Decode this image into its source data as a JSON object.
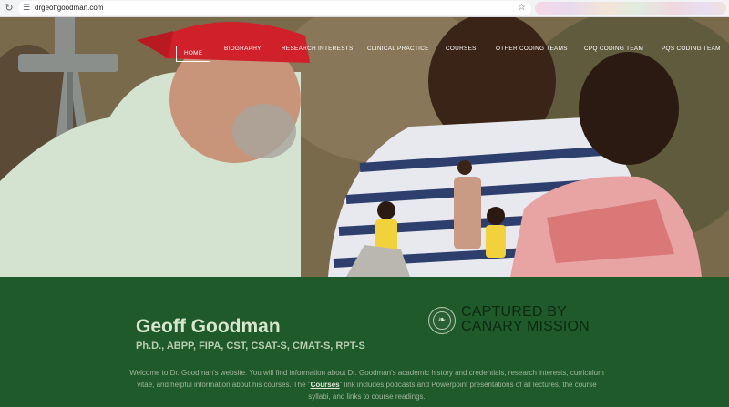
{
  "browser": {
    "url": "drgeoffgoodman.com",
    "reload_icon": "reload-icon",
    "site_info_icon": "site-info-icon",
    "bookmark_icon": "star-icon"
  },
  "nav": {
    "items": [
      {
        "label": "HOME",
        "active": true
      },
      {
        "label": "BIOGRAPHY"
      },
      {
        "label": "RESEARCH INTERESTS"
      },
      {
        "label": "CLINICAL PRACTICE"
      },
      {
        "label": "COURSES"
      },
      {
        "label": "OTHER CODING TEAMS"
      },
      {
        "label": "CPQ CODING TEAM"
      },
      {
        "label": "PQS CODING TEAM"
      }
    ]
  },
  "profile": {
    "name": "Geoff Goodman",
    "credentials": "Ph.D., ABPP, FIPA, CST, CSAT-S, CMAT-S, RPT-S"
  },
  "badge": {
    "line1": "CAPTURED BY",
    "line2": "CANARY MISSION",
    "icon": "canary-bird-icon"
  },
  "welcome": {
    "text_before": "Welcome to Dr. Goodman's website. You will find information about Dr. Goodman's academic history and credentials, research interests, curriculum vitae, and helpful information about his courses. The \"",
    "link": "Courses",
    "text_after": "\" link includes podcasts and Powerpoint presentations of all lectures, the course syllabi, and links to course readings."
  },
  "colors": {
    "band": "#1f5a2a",
    "name": "#d9e6cf",
    "credentials": "#b9cdb2",
    "bandana": "#d0212a"
  }
}
